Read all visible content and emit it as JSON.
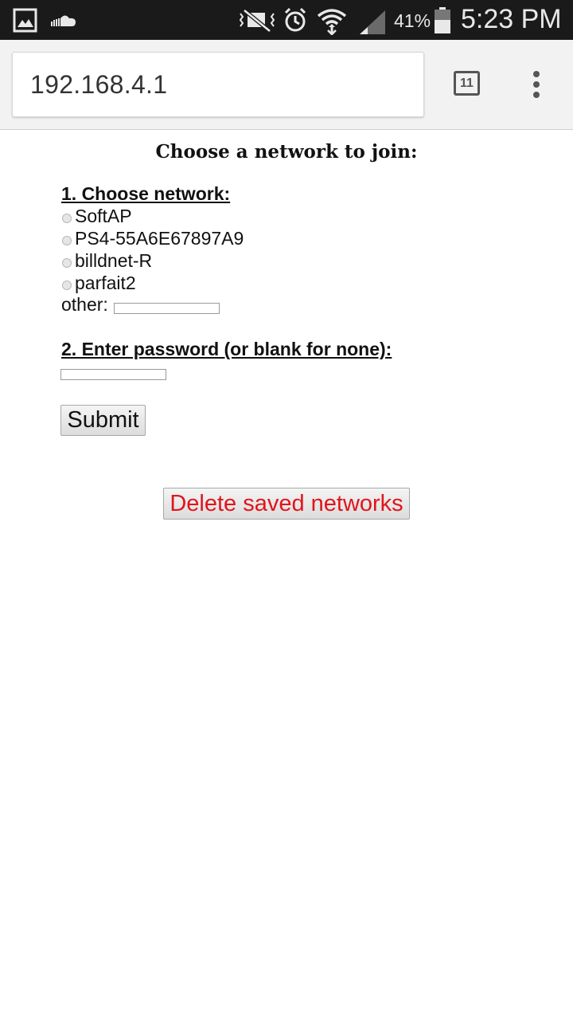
{
  "status_bar": {
    "battery": "41%",
    "time": "5:23 PM",
    "icons": [
      "gallery-icon",
      "cloud-icon",
      "mute-icon",
      "alarm-icon",
      "wifi-icon",
      "signal-icon",
      "battery-icon"
    ]
  },
  "browser": {
    "url": "192.168.4.1",
    "tab_count": "11"
  },
  "page": {
    "title": "Choose a network to join:",
    "section1": "1. Choose network:",
    "networks": [
      "SoftAP",
      "PS4-55A6E67897A9",
      "billdnet-R",
      "parfait2"
    ],
    "other_label": "other:",
    "section2": "2. Enter password (or blank for none):",
    "submit_label": "Submit",
    "delete_label": "Delete saved networks",
    "delete_color": "#e0151b"
  }
}
